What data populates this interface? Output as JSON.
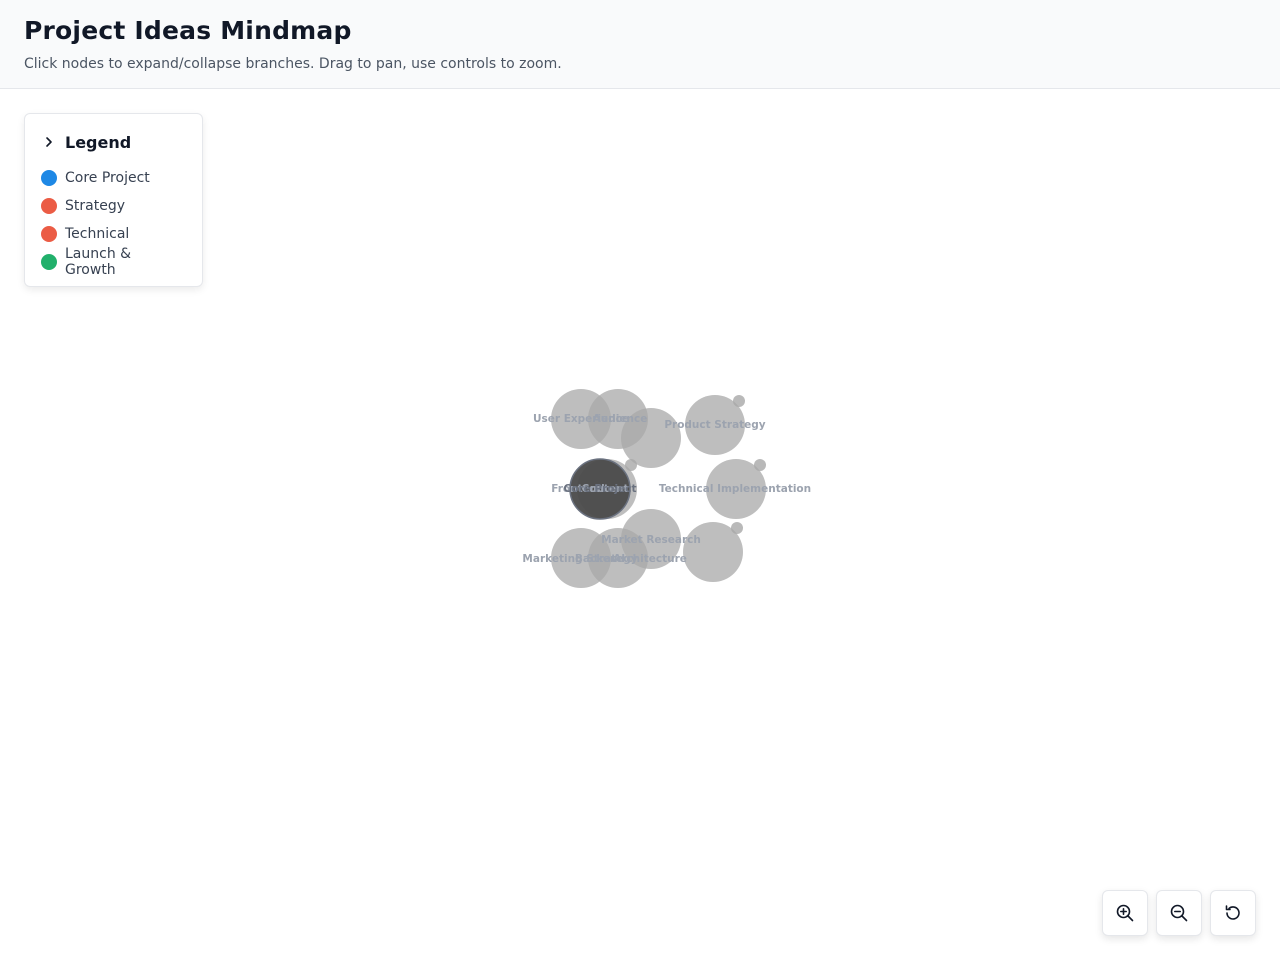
{
  "header": {
    "title": "Project Ideas Mindmap",
    "subtitle": "Click nodes to expand/collapse branches. Drag to pan, use controls to zoom."
  },
  "legend": {
    "title": "Legend",
    "items": [
      {
        "label": "Core Project",
        "color": "#1e88e5"
      },
      {
        "label": "Strategy",
        "color": "#eb5c45"
      },
      {
        "label": "Technical",
        "color": "#eb5c45"
      },
      {
        "label": "Launch & Growth",
        "color": "#21b06b"
      }
    ]
  },
  "mindmap": {
    "root": {
      "label": "Core Project"
    },
    "nodes": [
      {
        "label": "User Experience"
      },
      {
        "label": "Audience"
      },
      {
        "label": "Product Strategy"
      },
      {
        "label": "Frontend"
      },
      {
        "label": "Content"
      },
      {
        "label": "Technical Implementation"
      },
      {
        "label": "Market Research"
      },
      {
        "label": "Marketing Strategy"
      },
      {
        "label": "Backend"
      },
      {
        "label": "Architecture"
      }
    ]
  },
  "controls": {
    "zoom_in_icon": "zoom-in-icon",
    "zoom_out_icon": "zoom-out-icon",
    "reset_icon": "reset-icon"
  }
}
